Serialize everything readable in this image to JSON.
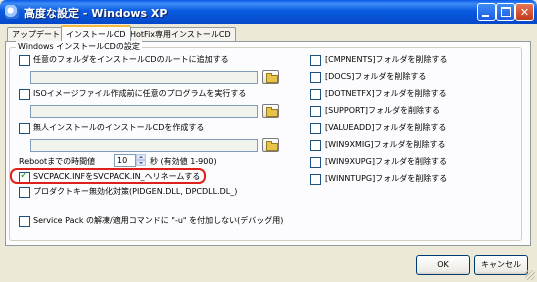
{
  "window": {
    "title": "高度な設定 - Windows XP"
  },
  "tabs": [
    {
      "label": "アップデート",
      "active": false
    },
    {
      "label": "インストールCD",
      "active": true
    },
    {
      "label": "HotFix専用インストールCD",
      "active": false
    }
  ],
  "group": {
    "title": "Windows インストールCDの設定"
  },
  "left_options": [
    {
      "label": "任意のフォルダをインストールCDのルートに追加する",
      "checked": false,
      "path": ""
    },
    {
      "label": "ISOイメージファイル作成前に任意のプログラムを実行する",
      "checked": false,
      "path": ""
    },
    {
      "label": "無人インストールのインストールCDを作成する",
      "checked": false,
      "path": ""
    }
  ],
  "reboot": {
    "label": "Rebootまでの時間値",
    "value": "10",
    "suffix": "秒 (有効値 1-900)"
  },
  "checks": [
    {
      "label": "SVCPACK.INFをSVCPACK.IN_へリネームする",
      "checked": true
    },
    {
      "label": "プロダクトキー無効化対策(PIDGEN.DLL, DPCDLL.DL_)",
      "checked": false
    },
    {
      "label": "Service Pack の解凍/適用コマンドに \"-u\" を付加しない(デバッグ用)",
      "checked": false
    }
  ],
  "right_options": [
    {
      "label": "[CMPNENTS]フォルダを削除する",
      "checked": false
    },
    {
      "label": "[DOCS]フォルダを削除する",
      "checked": false
    },
    {
      "label": "[DOTNETFX]フォルダを削除する",
      "checked": false
    },
    {
      "label": "[SUPPORT]フォルダを削除する",
      "checked": false
    },
    {
      "label": "[VALUEADD]フォルダを削除する",
      "checked": false
    },
    {
      "label": "[WIN9XMIG]フォルダを削除する",
      "checked": false
    },
    {
      "label": "[WIN9XUPG]フォルダを削除する",
      "checked": false
    },
    {
      "label": "[WINNTUPG]フォルダを削除する",
      "checked": false
    }
  ],
  "buttons": {
    "ok": "OK",
    "cancel": "キャンセル"
  },
  "colors": {
    "titlebar": "#0A59E8",
    "face": "#ECE9D8",
    "highlight_ring": "#E0201A",
    "check": "#21A121"
  }
}
